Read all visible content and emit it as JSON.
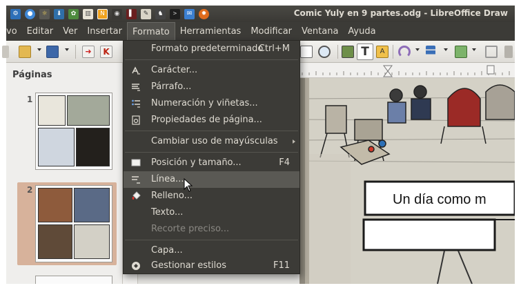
{
  "window": {
    "title": "Comic Yuly en 9 partes.odg - LibreOffice Draw"
  },
  "menubar": {
    "items": [
      "vo",
      "Editar",
      "Ver",
      "Insertar",
      "Formato",
      "Herramientas",
      "Modificar",
      "Ventana",
      "Ayuda"
    ],
    "active": "Formato"
  },
  "pages_panel": {
    "title": "Páginas",
    "pages": [
      {
        "number": "1"
      },
      {
        "number": "2"
      }
    ]
  },
  "format_menu": {
    "items": [
      {
        "label": "Formato predeterminado",
        "shortcut": "Ctrl+M",
        "icon": "",
        "enabled": true
      },
      {
        "label": "Carácter...",
        "shortcut": "",
        "icon": "character-icon",
        "enabled": true
      },
      {
        "label": "Párrafo...",
        "shortcut": "",
        "icon": "paragraph-icon",
        "enabled": true
      },
      {
        "label": "Numeración y viñetas...",
        "shortcut": "",
        "icon": "bullets-icon",
        "enabled": true
      },
      {
        "label": "Propiedades de página...",
        "shortcut": "",
        "icon": "page-properties-icon",
        "enabled": true
      },
      {
        "label": "Cambiar uso de mayúsculas",
        "shortcut": "",
        "icon": "",
        "enabled": true,
        "submenu": true
      },
      {
        "label": "Posición y tamaño...",
        "shortcut": "F4",
        "icon": "position-size-icon",
        "enabled": true
      },
      {
        "label": "Línea...",
        "shortcut": "",
        "icon": "line-icon",
        "enabled": true,
        "highlighted": true
      },
      {
        "label": "Relleno...",
        "shortcut": "",
        "icon": "fill-icon",
        "enabled": true
      },
      {
        "label": "Texto...",
        "shortcut": "",
        "icon": "",
        "enabled": true
      },
      {
        "label": "Recorte preciso...",
        "shortcut": "",
        "icon": "",
        "enabled": false
      },
      {
        "label": "Capa...",
        "shortcut": "",
        "icon": "",
        "enabled": true
      },
      {
        "label": "Gestionar estilos",
        "shortcut": "F11",
        "icon": "manage-styles-icon",
        "enabled": true
      }
    ]
  },
  "drawing": {
    "speech_text": "Un día como m"
  },
  "colors": {
    "panel_dark": "#3c3b37",
    "menu_text": "#dfdbd2",
    "page_highlight": "#d7b29b"
  }
}
